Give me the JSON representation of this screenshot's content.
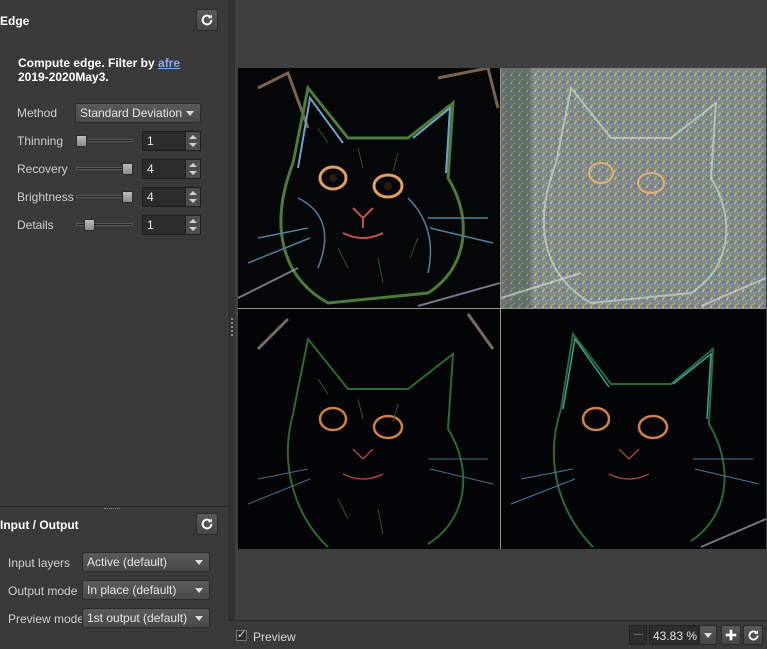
{
  "filter": {
    "title": "Edge",
    "description_prefix": "Compute edge.  Filter by ",
    "author_link": "afre",
    "description_suffix": "2019-2020May3.",
    "params": {
      "method": {
        "label": "Method",
        "value": "Standard Deviation"
      },
      "thinning": {
        "label": "Thinning",
        "value": "1",
        "level": 0.0
      },
      "recovery": {
        "label": "Recovery",
        "value": "4",
        "level": 1.0
      },
      "brightness": {
        "label": "Brightness",
        "value": "4",
        "level": 1.0
      },
      "details": {
        "label": "Details",
        "value": "1",
        "level": 0.2
      }
    }
  },
  "io": {
    "title": "Input / Output",
    "input_layers": {
      "label": "Input layers",
      "value": "Active (default)"
    },
    "output_mode": {
      "label": "Output mode",
      "value": "In place (default)"
    },
    "preview_mode": {
      "label": "Preview mode",
      "value": "1st output (default)"
    }
  },
  "bottom": {
    "preview_label": "Preview",
    "preview_checked": true,
    "zoom": "43.83 %"
  },
  "icons": {
    "reset": "refresh-icon",
    "zoom_in": "zoom-in-icon",
    "zoom_reset": "refresh-icon"
  }
}
